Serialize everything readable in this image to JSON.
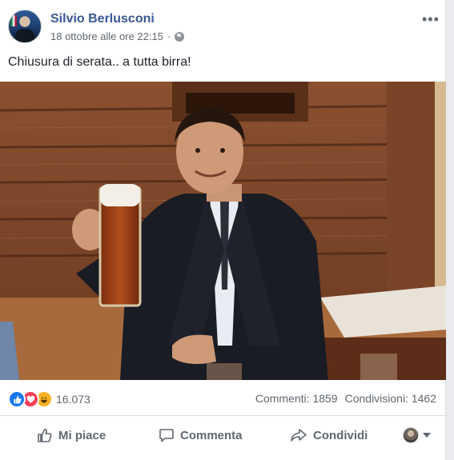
{
  "post": {
    "author": "Silvio Berlusconi",
    "timestamp": "18 ottobre alle ore 22:15",
    "privacy_icon": "globe-icon",
    "more_label": "•••",
    "caption": "Chiusura di serata.. a tutta birra!"
  },
  "stats": {
    "reaction_icons": [
      "like-icon",
      "love-icon",
      "haha-icon"
    ],
    "reaction_count": "16.073",
    "comments": "Commenti: 1859",
    "shares": "Condivisioni: 1462"
  },
  "actions": {
    "like": "Mi piace",
    "comment": "Commenta",
    "share": "Condividi"
  },
  "colors": {
    "brand": "#385898",
    "like": "#1877f2",
    "love": "#f33e58",
    "haha": "#f7b125",
    "muted": "#606770"
  }
}
